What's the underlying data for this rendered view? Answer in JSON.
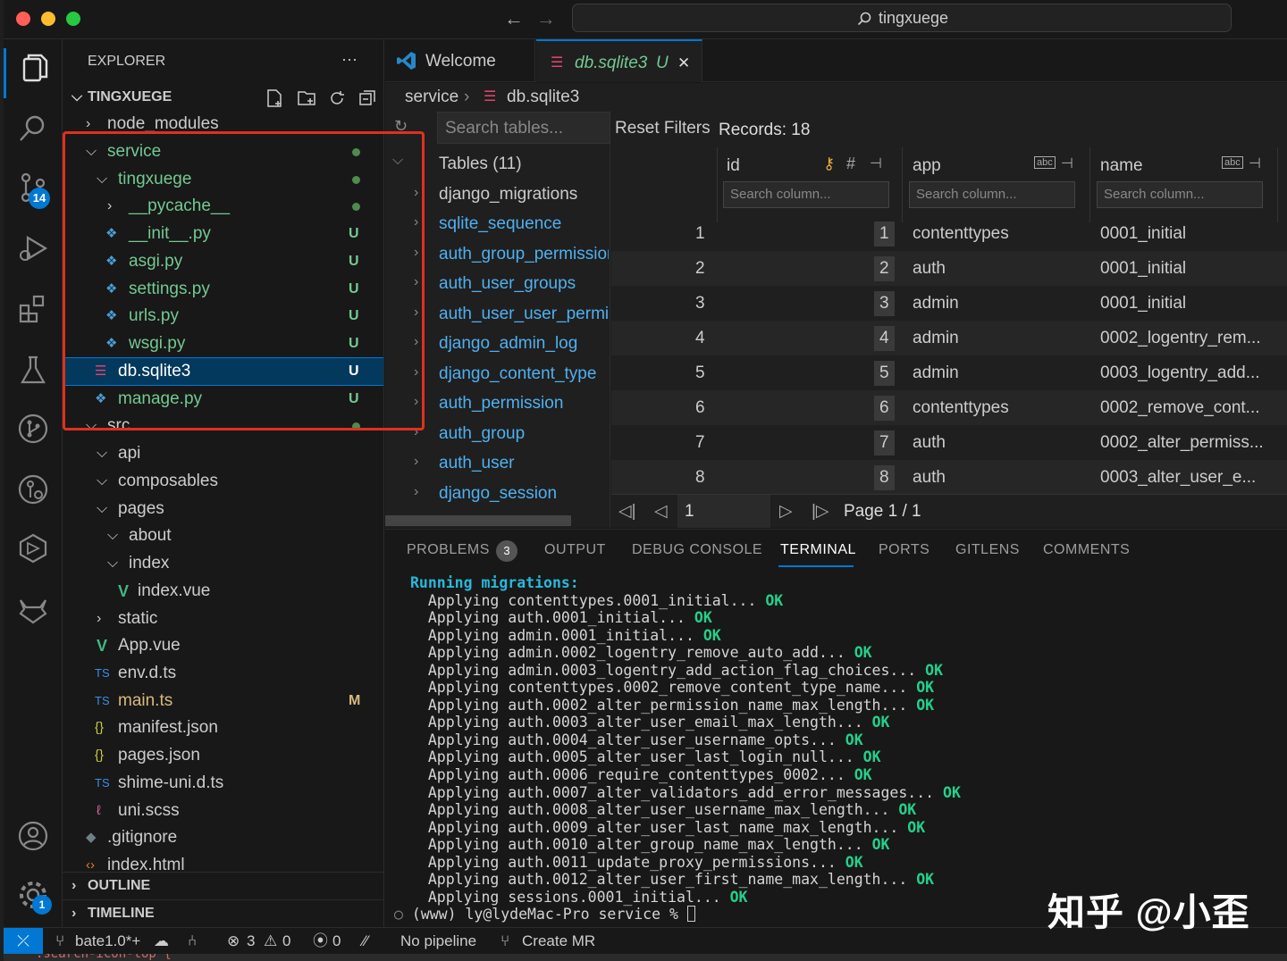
{
  "titlebar": {
    "search": "tingxuege"
  },
  "activity": {
    "scm_badge": "14",
    "settings_badge": "1"
  },
  "explorer": {
    "title": "EXPLORER",
    "more": "···",
    "root": "TINGXUEGE",
    "items": [
      {
        "label": "node_modules"
      },
      {
        "label": "service"
      },
      {
        "label": "tingxuege"
      },
      {
        "label": "__pycache__"
      },
      {
        "label": "__init__.py",
        "status": "U"
      },
      {
        "label": "asgi.py",
        "status": "U"
      },
      {
        "label": "settings.py",
        "status": "U"
      },
      {
        "label": "urls.py",
        "status": "U"
      },
      {
        "label": "wsgi.py",
        "status": "U"
      },
      {
        "label": "db.sqlite3",
        "status": "U"
      },
      {
        "label": "manage.py",
        "status": "U"
      },
      {
        "label": "src"
      },
      {
        "label": "api"
      },
      {
        "label": "composables"
      },
      {
        "label": "pages"
      },
      {
        "label": "about"
      },
      {
        "label": "index"
      },
      {
        "label": "index.vue"
      },
      {
        "label": "static"
      },
      {
        "label": "App.vue"
      },
      {
        "label": "env.d.ts"
      },
      {
        "label": "main.ts",
        "status": "M"
      },
      {
        "label": "manifest.json"
      },
      {
        "label": "pages.json"
      },
      {
        "label": "shime-uni.d.ts"
      },
      {
        "label": "uni.scss"
      },
      {
        "label": ".gitignore"
      },
      {
        "label": "index.html"
      }
    ],
    "outline": "OUTLINE",
    "timeline": "TIMELINE"
  },
  "tabs": [
    {
      "label": "Welcome"
    },
    {
      "label": "db.sqlite3",
      "suffix": "U",
      "close": "✕"
    }
  ],
  "breadcrumb": {
    "folder": "service",
    "file": "db.sqlite3"
  },
  "db": {
    "search_placeholder": "Search tables...",
    "reset": "Reset Filters",
    "records": "Records: 18",
    "tables_header": "Tables (11)",
    "tables": [
      "django_migrations",
      "sqlite_sequence",
      "auth_group_permissions",
      "auth_user_groups",
      "auth_user_user_permissions",
      "django_admin_log",
      "django_content_type",
      "auth_permission",
      "auth_group",
      "auth_user",
      "django_session"
    ],
    "columns": [
      {
        "name": "id",
        "search": "Search column..."
      },
      {
        "name": "app",
        "search": "Search column..."
      },
      {
        "name": "name",
        "search": "Search column..."
      }
    ],
    "rows": [
      {
        "n": "1",
        "id": "1",
        "app": "contenttypes",
        "name": "0001_initial"
      },
      {
        "n": "2",
        "id": "2",
        "app": "auth",
        "name": "0001_initial"
      },
      {
        "n": "3",
        "id": "3",
        "app": "admin",
        "name": "0001_initial"
      },
      {
        "n": "4",
        "id": "4",
        "app": "admin",
        "name": "0002_logentry_rem..."
      },
      {
        "n": "5",
        "id": "5",
        "app": "admin",
        "name": "0003_logentry_add..."
      },
      {
        "n": "6",
        "id": "6",
        "app": "contenttypes",
        "name": "0002_remove_cont..."
      },
      {
        "n": "7",
        "id": "7",
        "app": "auth",
        "name": "0002_alter_permiss..."
      },
      {
        "n": "8",
        "id": "8",
        "app": "auth",
        "name": "0003_alter_user_e..."
      }
    ],
    "page_input": "1",
    "page_label": "Page 1 / 1"
  },
  "panel": {
    "tabs": [
      "PROBLEMS",
      "OUTPUT",
      "DEBUG CONSOLE",
      "TERMINAL",
      "PORTS",
      "GITLENS",
      "COMMENTS"
    ],
    "problems_count": "3",
    "terminal": {
      "heading": "Running migrations:",
      "lines": [
        "Applying contenttypes.0001_initial...",
        "Applying auth.0001_initial...",
        "Applying admin.0001_initial...",
        "Applying admin.0002_logentry_remove_auto_add...",
        "Applying admin.0003_logentry_add_action_flag_choices...",
        "Applying contenttypes.0002_remove_content_type_name...",
        "Applying auth.0002_alter_permission_name_max_length...",
        "Applying auth.0003_alter_user_email_max_length...",
        "Applying auth.0004_alter_user_username_opts...",
        "Applying auth.0005_alter_user_last_login_null...",
        "Applying auth.0006_require_contenttypes_0002...",
        "Applying auth.0007_alter_validators_add_error_messages...",
        "Applying auth.0008_alter_user_username_max_length...",
        "Applying auth.0009_alter_user_last_name_max_length...",
        "Applying auth.0010_alter_group_name_max_length...",
        "Applying auth.0011_update_proxy_permissions...",
        "Applying auth.0012_alter_user_first_name_max_length...",
        "Applying sessions.0001_initial..."
      ],
      "ok": "OK",
      "prompt": "(www) ly@lydeMac-Pro service % "
    }
  },
  "status": {
    "branch": "bate1.0*+",
    "errors": "3",
    "warnings": "0",
    "ports": "0",
    "pipeline": "No pipeline",
    "mr": "Create MR"
  },
  "watermark": "知乎 @小歪",
  "below_text": ".search-icon-top {"
}
